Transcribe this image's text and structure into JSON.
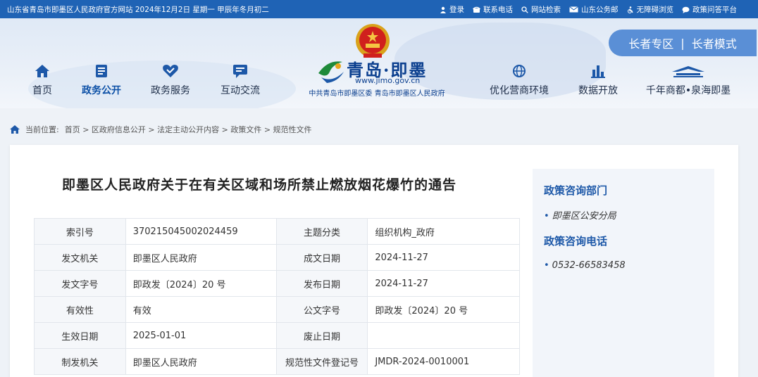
{
  "topbar": {
    "site_info": "山东省青岛市即墨区人民政府官方网站  2024年12月2日 星期一 甲辰年冬月初二",
    "links": [
      {
        "label": "登录",
        "icon": "user-icon"
      },
      {
        "label": "联系电话",
        "icon": "phone-icon"
      },
      {
        "label": "网站检索",
        "icon": "search-icon"
      },
      {
        "label": "山东公务邮",
        "icon": "mail-icon"
      },
      {
        "label": "无障碍浏览",
        "icon": "accessibility-icon"
      },
      {
        "label": "政策问答平台",
        "icon": "chat-icon"
      }
    ]
  },
  "header": {
    "brand": "青岛·即墨",
    "url": "www.jimo.gov.cn",
    "subtitle": "中共青岛市即墨区委  青岛市即墨区人民政府",
    "elder_zone": "长者专区",
    "elder_sep": "|",
    "elder_mode": "长者模式"
  },
  "nav": [
    {
      "label": "首页",
      "icon": "home-icon"
    },
    {
      "label": "政务公开",
      "icon": "document-icon"
    },
    {
      "label": "政务服务",
      "icon": "heart-icon"
    },
    {
      "label": "互动交流",
      "icon": "message-icon"
    },
    {
      "label": "优化营商环境",
      "icon": "globe-icon"
    },
    {
      "label": "数据开放",
      "icon": "bar-chart-icon"
    },
    {
      "label": "千年商都•泉海即墨",
      "icon": "landmark-icon"
    }
  ],
  "breadcrumb": {
    "prefix": "当前位置:",
    "path": "首页 > 区政府信息公开 > 法定主动公开内容 > 政策文件 > 规范性文件"
  },
  "article": {
    "title": "即墨区人民政府关于在有关区域和场所禁止燃放烟花爆竹的通告"
  },
  "info_table": [
    [
      "索引号",
      "370215045002024459",
      "主题分类",
      "组织机构_政府"
    ],
    [
      "发文机关",
      "即墨区人民政府",
      "成文日期",
      "2024-11-27"
    ],
    [
      "发文字号",
      "即政发〔2024〕20 号",
      "发布日期",
      "2024-11-27"
    ],
    [
      "有效性",
      "有效",
      "公文字号",
      "即政发〔2024〕20 号"
    ],
    [
      "生效日期",
      "2025-01-01",
      "废止日期",
      ""
    ],
    [
      "制发机关",
      "即墨区人民政府",
      "规范性文件登记号",
      "JMDR-2024-0010001"
    ]
  ],
  "sidebar": {
    "dept_heading": "政策咨询部门",
    "dept_value": "即墨区公安分局",
    "phone_heading": "政策咨询电话",
    "phone_value": "0532-66583458",
    "bullet": "•"
  },
  "colors": {
    "topbar_bg": "#1f63b5",
    "brand_blue": "#0b3f8f",
    "elder_bg": "#5a8fd6",
    "heading_blue": "#1d58a8"
  }
}
